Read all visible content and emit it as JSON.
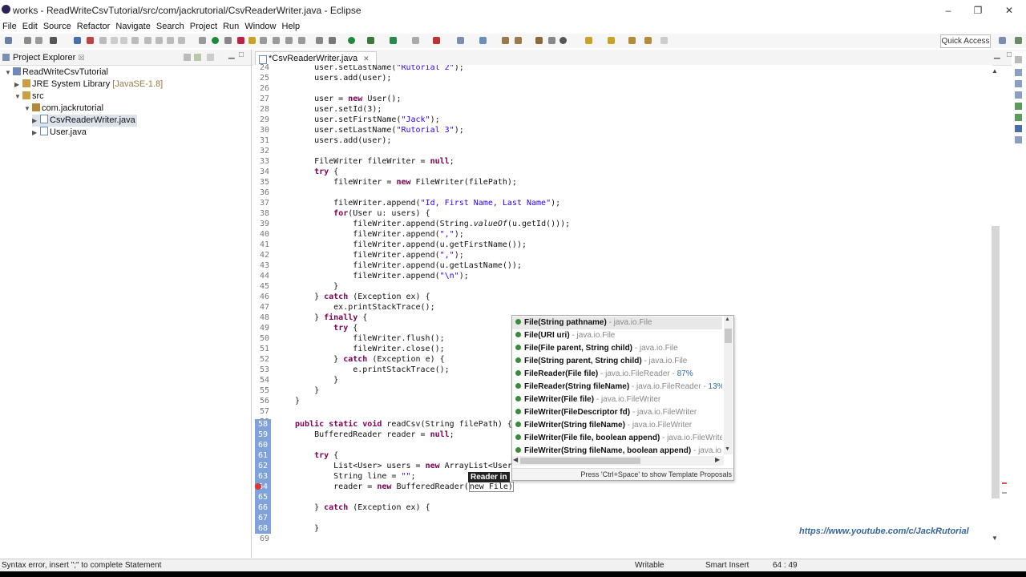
{
  "window": {
    "title": "works - ReadWriteCsvTutorial/src/com/jackrutorial/CsvReaderWriter.java - Eclipse",
    "minimize": "–",
    "maximize": "❐",
    "close": "✕"
  },
  "menu": [
    "File",
    "Edit",
    "Source",
    "Refactor",
    "Navigate",
    "Search",
    "Project",
    "Run",
    "Window",
    "Help"
  ],
  "toolbar": {
    "quick_access": "Quick Access"
  },
  "explorer": {
    "title": "Project Explorer",
    "tab_suffix": "☒",
    "items": [
      {
        "label": "ReadWriteCsvTutorial",
        "decor": ""
      },
      {
        "label": "JRE System Library",
        "decor": "[JavaSE-1.8]"
      },
      {
        "label": "src",
        "decor": ""
      },
      {
        "label": "com.jackrutorial",
        "decor": ""
      },
      {
        "label": "CsvReaderWriter.java",
        "decor": ""
      },
      {
        "label": "User.java",
        "decor": ""
      }
    ]
  },
  "editor": {
    "tab_label": "*CsvReaderWriter.java",
    "line_numbers": [
      "24",
      "25",
      "26",
      "27",
      "28",
      "29",
      "30",
      "31",
      "32",
      "33",
      "34",
      "35",
      "36",
      "37",
      "38",
      "39",
      "40",
      "41",
      "42",
      "43",
      "44",
      "45",
      "46",
      "47",
      "48",
      "49",
      "50",
      "51",
      "52",
      "53",
      "54",
      "55",
      "56",
      "57",
      "58",
      "59",
      "60",
      "61",
      "62",
      "63",
      "64",
      "65",
      "66",
      "67",
      "68",
      "69"
    ]
  },
  "content_assist": {
    "items": [
      {
        "name": "File(String pathname)",
        "pkg": " - java.io.File",
        "pct": ""
      },
      {
        "name": "File(URI uri)",
        "pkg": " - java.io.File",
        "pct": ""
      },
      {
        "name": "File(File parent, String child)",
        "pkg": " - java.io.File",
        "pct": ""
      },
      {
        "name": "File(String parent, String child)",
        "pkg": " - java.io.File",
        "pct": ""
      },
      {
        "name": "FileReader(File file)",
        "pkg": " - java.io.FileReader - ",
        "pct": "87%"
      },
      {
        "name": "FileReader(String fileName)",
        "pkg": " - java.io.FileReader - ",
        "pct": "13%"
      },
      {
        "name": "FileWriter(File file)",
        "pkg": " - java.io.FileWriter",
        "pct": ""
      },
      {
        "name": "FileWriter(FileDescriptor fd)",
        "pkg": " - java.io.FileWriter",
        "pct": ""
      },
      {
        "name": "FileWriter(String fileName)",
        "pkg": " - java.io.FileWriter",
        "pct": ""
      },
      {
        "name": "FileWriter(File file, boolean append)",
        "pkg": " - java.io.FileWriter",
        "pct": ""
      },
      {
        "name": "FileWriter(String fileName, boolean append)",
        "pkg": " - java.io.File",
        "pct": ""
      }
    ],
    "hint": "Press 'Ctrl+Space' to show Template Proposals"
  },
  "tooltip": "Reader in",
  "watermark": "https://www.youtube.com/c/JackRutorial",
  "status": {
    "message": "Syntax error, insert \";\" to complete Statement",
    "writable": "Writable",
    "insert_mode": "Smart Insert",
    "position": "64 : 49"
  }
}
